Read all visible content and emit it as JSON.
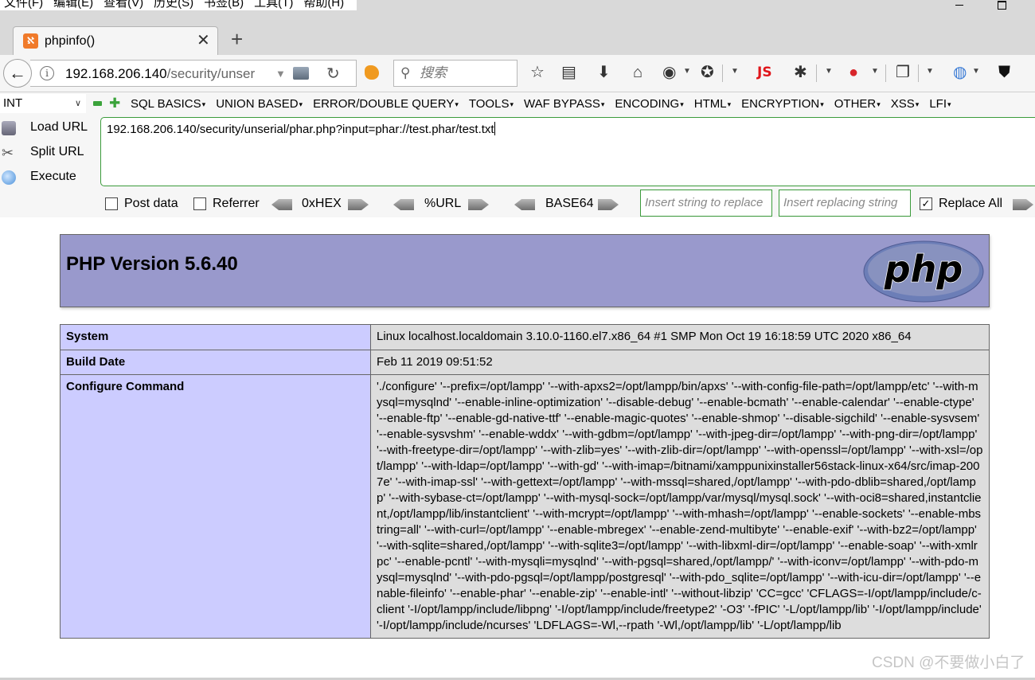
{
  "menubar": {
    "items": [
      "文件(F)",
      "编辑(E)",
      "查看(V)",
      "历史(S)",
      "书签(B)",
      "工具(T)",
      "帮助(H)"
    ]
  },
  "tab": {
    "title": "phpinfo()",
    "favicon": "xampp-icon",
    "close": "✕",
    "new_tab": "+"
  },
  "navbar": {
    "url_host": "192.168.206.140",
    "url_path": "/security/unser",
    "search_placeholder": "搜索",
    "js_label": "JS"
  },
  "hackbar": {
    "type_select": "INT",
    "menu": [
      "SQL BASICS",
      "UNION BASED",
      "ERROR/DOUBLE QUERY",
      "TOOLS",
      "WAF BYPASS",
      "ENCODING",
      "HTML",
      "ENCRYPTION",
      "OTHER",
      "XSS",
      "LFI"
    ],
    "load_url": "Load URL",
    "split_url": "Split URL",
    "execute": "Execute",
    "url_value": "192.168.206.140/security/unserial/phar.php?input=phar://test.phar/test.txt",
    "post_data": "Post data",
    "post_data_checked": false,
    "referrer": "Referrer",
    "referrer_checked": false,
    "hex": "0xHEX",
    "url_enc": "%URL",
    "base64": "BASE64",
    "replace_placeholder": "Insert string to replace",
    "replacing_placeholder": "Insert replacing string",
    "replace_all": "Replace All",
    "replace_all_checked": true
  },
  "phpinfo": {
    "version_title": "PHP Version 5.6.40",
    "logo_text": "php",
    "rows": [
      {
        "key": "System",
        "value": "Linux localhost.localdomain 3.10.0-1160.el7.x86_64 #1 SMP Mon Oct 19 16:18:59 UTC 2020 x86_64"
      },
      {
        "key": "Build Date",
        "value": "Feb 11 2019 09:51:52"
      },
      {
        "key": "Configure Command",
        "value": "'./configure' '--prefix=/opt/lampp' '--with-apxs2=/opt/lampp/bin/apxs' '--with-config-file-path=/opt/lampp/etc' '--with-mysql=mysqlnd' '--enable-inline-optimization' '--disable-debug' '--enable-bcmath' '--enable-calendar' '--enable-ctype' '--enable-ftp' '--enable-gd-native-ttf' '--enable-magic-quotes' '--enable-shmop' '--disable-sigchild' '--enable-sysvsem' '--enable-sysvshm' '--enable-wddx' '--with-gdbm=/opt/lampp' '--with-jpeg-dir=/opt/lampp' '--with-png-dir=/opt/lampp' '--with-freetype-dir=/opt/lampp' '--with-zlib=yes' '--with-zlib-dir=/opt/lampp' '--with-openssl=/opt/lampp' '--with-xsl=/opt/lampp' '--with-ldap=/opt/lampp' '--with-gd' '--with-imap=/bitnami/xamppunixinstaller56stack-linux-x64/src/imap-2007e' '--with-imap-ssl' '--with-gettext=/opt/lampp' '--with-mssql=shared,/opt/lampp' '--with-pdo-dblib=shared,/opt/lampp' '--with-sybase-ct=/opt/lampp' '--with-mysql-sock=/opt/lampp/var/mysql/mysql.sock' '--with-oci8=shared,instantclient,/opt/lampp/lib/instantclient' '--with-mcrypt=/opt/lampp' '--with-mhash=/opt/lampp' '--enable-sockets' '--enable-mbstring=all' '--with-curl=/opt/lampp' '--enable-mbregex' '--enable-zend-multibyte' '--enable-exif' '--with-bz2=/opt/lampp' '--with-sqlite=shared,/opt/lampp' '--with-sqlite3=/opt/lampp' '--with-libxml-dir=/opt/lampp' '--enable-soap' '--with-xmlrpc' '--enable-pcntl' '--with-mysqli=mysqlnd' '--with-pgsql=shared,/opt/lampp/' '--with-iconv=/opt/lampp' '--with-pdo-mysql=mysqlnd' '--with-pdo-pgsql=/opt/lampp/postgresql' '--with-pdo_sqlite=/opt/lampp' '--with-icu-dir=/opt/lampp' '--enable-fileinfo' '--enable-phar' '--enable-zip' '--enable-intl' '--without-libzip' 'CC=gcc' 'CFLAGS=-I/opt/lampp/include/c-client '-I/opt/lampp/include/libpng' '-I/opt/lampp/include/freetype2' '-O3' '-fPIC' '-L/opt/lampp/lib' '-I/opt/lampp/include' '-I/opt/lampp/include/ncurses' 'LDFLAGS=-Wl,--rpath '-Wl,/opt/lampp/lib' '-L/opt/lampp/lib"
      }
    ]
  },
  "watermark": "CSDN @不要做小白了",
  "colors": {
    "php_header": "#9999cc",
    "key_cell": "#ccccff",
    "value_cell": "#dddddd",
    "hackbar_border": "#3b9b3b"
  }
}
